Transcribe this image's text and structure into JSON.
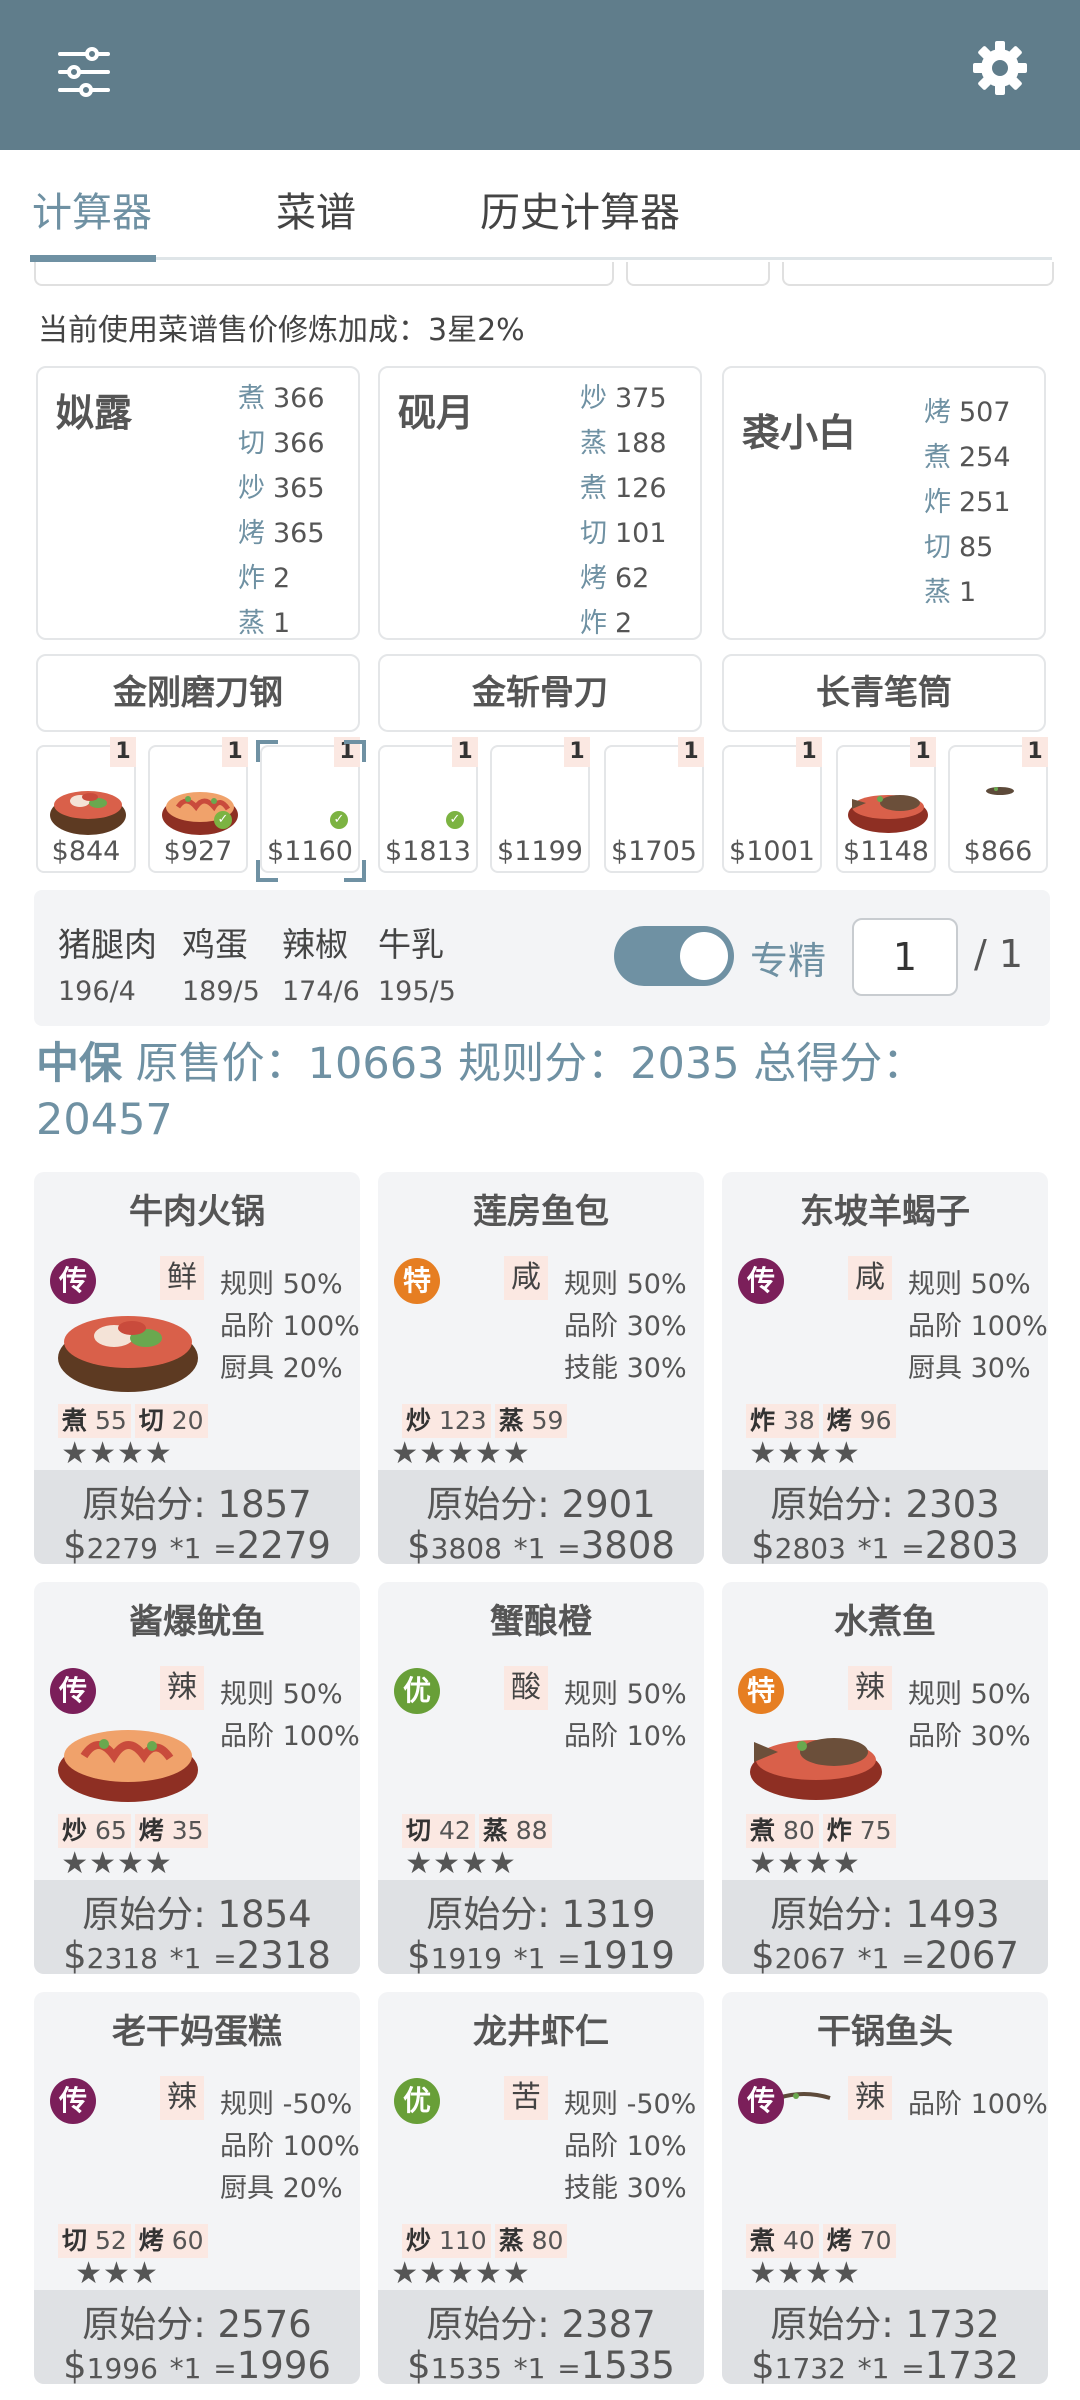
{
  "appbar": {
    "filter_icon": "sliders-icon",
    "settings_icon": "gear-icon"
  },
  "tabs": [
    {
      "label": "计算器",
      "active": true
    },
    {
      "label": "菜谱",
      "active": false
    },
    {
      "label": "历史计算器",
      "active": false
    }
  ],
  "bonus_text": "当前使用菜谱售价修炼加成：3星2%",
  "chefs": [
    {
      "name": "姒露",
      "skills": [
        {
          "k": "煮",
          "v": "366"
        },
        {
          "k": "切",
          "v": "366"
        },
        {
          "k": "炒",
          "v": "365"
        },
        {
          "k": "烤",
          "v": "365"
        },
        {
          "k": "炸",
          "v": "2"
        },
        {
          "k": "蒸",
          "v": "1"
        }
      ]
    },
    {
      "name": "砚月",
      "skills": [
        {
          "k": "炒",
          "v": "375"
        },
        {
          "k": "蒸",
          "v": "188"
        },
        {
          "k": "煮",
          "v": "126"
        },
        {
          "k": "切",
          "v": "101"
        },
        {
          "k": "烤",
          "v": "62"
        },
        {
          "k": "炸",
          "v": "2"
        }
      ]
    },
    {
      "name": "裘小白",
      "skills": [
        {
          "k": "烤",
          "v": "507"
        },
        {
          "k": "煮",
          "v": "254"
        },
        {
          "k": "炸",
          "v": "251"
        },
        {
          "k": "切",
          "v": "85"
        },
        {
          "k": "蒸",
          "v": "1"
        }
      ]
    }
  ],
  "equipment": [
    "金刚磨刀钢",
    "金斩骨刀",
    "长青笔筒"
  ],
  "recipe_slots": [
    {
      "price": "$844",
      "count": "1",
      "checked": false,
      "image": "hotpot"
    },
    {
      "price": "$927",
      "count": "1",
      "checked": true,
      "image": "squid"
    },
    {
      "price": "$1160",
      "count": "1",
      "checked": true,
      "image": "none",
      "selected": true
    },
    {
      "price": "$1813",
      "count": "1",
      "checked": true,
      "image": "none"
    },
    {
      "price": "$1199",
      "count": "1",
      "checked": false,
      "image": "none"
    },
    {
      "price": "$1705",
      "count": "1",
      "checked": false,
      "image": "none"
    },
    {
      "price": "$1001",
      "count": "1",
      "checked": false,
      "image": "none"
    },
    {
      "price": "$1148",
      "count": "1",
      "checked": false,
      "image": "fish"
    },
    {
      "price": "$866",
      "count": "1",
      "checked": false,
      "image": "tiny"
    }
  ],
  "ingredients": [
    {
      "name": "猪腿肉",
      "value": "196/4"
    },
    {
      "name": "鸡蛋",
      "value": "189/5"
    },
    {
      "name": "辣椒",
      "value": "174/6"
    },
    {
      "name": "牛乳",
      "value": "195/5"
    }
  ],
  "specialize": {
    "label": "专精",
    "on": true,
    "quantity": "1",
    "total": "/ 1"
  },
  "summary": {
    "grade": "中保",
    "original_price_label": "原售价：",
    "original_price": "10663",
    "rule_label": "规则分：",
    "rule_score": "2035",
    "total_label": "总得分：",
    "total_score": "20457"
  },
  "colors": {
    "accent": "#607d8b",
    "legendary": "#7b1f5a",
    "special": "#e67e22",
    "excellent": "#689f38"
  },
  "dishes": [
    {
      "name": "牛肉火锅",
      "rarity": "传",
      "rarity_type": "legendary",
      "flavor": "鲜",
      "rules": [
        "规则 50%",
        "品阶 100%",
        "厨具 20%"
      ],
      "skills": [
        {
          "k": "煮",
          "v": "55"
        },
        {
          "k": "切",
          "v": "20"
        }
      ],
      "stars": "★★★★",
      "raw": "原始分: 1857",
      "price": "2279",
      "mult": "*1",
      "result": "2279",
      "image": "hotpot"
    },
    {
      "name": "莲房鱼包",
      "rarity": "特",
      "rarity_type": "special",
      "flavor": "咸",
      "rules": [
        "规则 50%",
        "品阶 30%",
        "技能 30%"
      ],
      "skills": [
        {
          "k": "炒",
          "v": "123"
        },
        {
          "k": "蒸",
          "v": "59"
        }
      ],
      "stars": "★★★★★",
      "raw": "原始分: 2901",
      "price": "3808",
      "mult": "*1",
      "result": "3808",
      "image": "none"
    },
    {
      "name": "东坡羊蝎子",
      "rarity": "传",
      "rarity_type": "legendary",
      "flavor": "咸",
      "rules": [
        "规则 50%",
        "品阶 100%",
        "厨具 30%"
      ],
      "skills": [
        {
          "k": "炸",
          "v": "38"
        },
        {
          "k": "烤",
          "v": "96"
        }
      ],
      "stars": "★★★★",
      "raw": "原始分: 2303",
      "price": "2803",
      "mult": "*1",
      "result": "2803",
      "image": "none"
    },
    {
      "name": "酱爆鱿鱼",
      "rarity": "传",
      "rarity_type": "legendary",
      "flavor": "辣",
      "rules": [
        "规则 50%",
        "品阶 100%"
      ],
      "skills": [
        {
          "k": "炒",
          "v": "65"
        },
        {
          "k": "烤",
          "v": "35"
        }
      ],
      "stars": "★★★★",
      "raw": "原始分: 1854",
      "price": "2318",
      "mult": "*1",
      "result": "2318",
      "image": "squid"
    },
    {
      "name": "蟹酿橙",
      "rarity": "优",
      "rarity_type": "excellent",
      "flavor": "酸",
      "rules": [
        "规则 50%",
        "品阶 10%"
      ],
      "skills": [
        {
          "k": "切",
          "v": "42"
        },
        {
          "k": "蒸",
          "v": "88"
        }
      ],
      "stars": "★★★★",
      "raw": "原始分: 1319",
      "price": "1919",
      "mult": "*1",
      "result": "1919",
      "image": "none"
    },
    {
      "name": "水煮鱼",
      "rarity": "特",
      "rarity_type": "special",
      "flavor": "辣",
      "rules": [
        "规则 50%",
        "品阶 30%"
      ],
      "skills": [
        {
          "k": "煮",
          "v": "80"
        },
        {
          "k": "炸",
          "v": "75"
        }
      ],
      "stars": "★★★★",
      "raw": "原始分: 1493",
      "price": "2067",
      "mult": "*1",
      "result": "2067",
      "image": "fish"
    },
    {
      "name": "老干妈蛋糕",
      "rarity": "传",
      "rarity_type": "legendary",
      "flavor": "辣",
      "rules": [
        "规则 -50%",
        "品阶 100%",
        "厨具 20%"
      ],
      "skills": [
        {
          "k": "切",
          "v": "52"
        },
        {
          "k": "烤",
          "v": "60"
        }
      ],
      "stars": "★★★",
      "raw": "原始分: 2576",
      "price": "1996",
      "mult": "*1",
      "result": "1996",
      "image": "none"
    },
    {
      "name": "龙井虾仁",
      "rarity": "优",
      "rarity_type": "excellent",
      "flavor": "苦",
      "rules": [
        "规则 -50%",
        "品阶 10%",
        "技能 30%"
      ],
      "skills": [
        {
          "k": "炒",
          "v": "110"
        },
        {
          "k": "蒸",
          "v": "80"
        }
      ],
      "stars": "★★★★★",
      "raw": "原始分: 2387",
      "price": "1535",
      "mult": "*1",
      "result": "1535",
      "image": "none"
    },
    {
      "name": "干锅鱼头",
      "rarity": "传",
      "rarity_type": "legendary",
      "flavor": "辣",
      "rules": [
        "品阶 100%"
      ],
      "skills": [
        {
          "k": "煮",
          "v": "40"
        },
        {
          "k": "烤",
          "v": "70"
        }
      ],
      "stars": "★★★★",
      "raw": "原始分: 1732",
      "price": "1732",
      "mult": "*1",
      "result": "1732",
      "image": "tiny"
    }
  ]
}
